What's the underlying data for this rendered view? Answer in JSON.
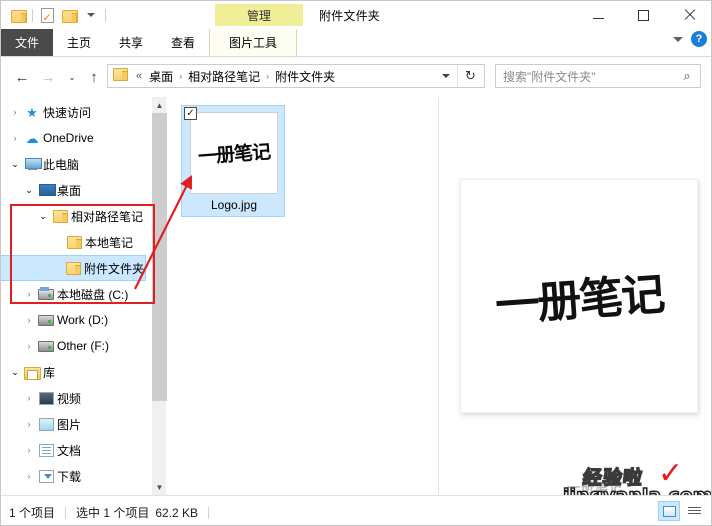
{
  "window": {
    "title": "附件文件夹",
    "minimize_label": "最小化",
    "maximize_label": "最大化",
    "close_label": "关闭"
  },
  "quick_access_toolbar": {
    "items": [
      {
        "name": "folder-icon",
        "label": "属性"
      },
      {
        "name": "properties-icon",
        "label": "属性"
      },
      {
        "name": "new-folder-icon",
        "label": "新建文件夹"
      },
      {
        "name": "customize-caret-icon",
        "label": "自定义快速访问工具栏"
      }
    ]
  },
  "ribbon": {
    "contextual_group_label": "管理",
    "tabs": [
      {
        "label": "文件",
        "active": true
      },
      {
        "label": "主页",
        "active": false
      },
      {
        "label": "共享",
        "active": false
      },
      {
        "label": "查看",
        "active": false
      },
      {
        "label": "图片工具",
        "active": false,
        "contextual": true
      }
    ],
    "collapse_label": "展开功能区",
    "help_label": "?"
  },
  "navigation": {
    "back_label": "←",
    "forward_label": "→",
    "recent_label": "⌄",
    "up_label": "↑",
    "refresh_label": "↻",
    "dropdown_label": "⌄"
  },
  "address_bar": {
    "separator": "«",
    "crumbs": [
      "桌面",
      "相对路径笔记",
      "附件文件夹"
    ],
    "crumb_separator": "›"
  },
  "search": {
    "placeholder": "搜索\"附件文件夹\"",
    "icon": "search-icon"
  },
  "tree": {
    "items": [
      {
        "label": "快速访问",
        "indent": 0,
        "twist": "›",
        "icon": "star-icon",
        "selected": false
      },
      {
        "label": "OneDrive",
        "indent": 0,
        "twist": "›",
        "icon": "cloud-icon",
        "selected": false
      },
      {
        "label": "此电脑",
        "indent": 0,
        "twist": "⌄",
        "icon": "pc-icon",
        "selected": false
      },
      {
        "label": "桌面",
        "indent": 1,
        "twist": "⌄",
        "icon": "desktop-icon",
        "selected": false
      },
      {
        "label": "相对路径笔记",
        "indent": 2,
        "twist": "⌄",
        "icon": "folder-icon",
        "selected": false
      },
      {
        "label": "本地笔记",
        "indent": 3,
        "twist": "",
        "icon": "folder-icon",
        "selected": false
      },
      {
        "label": "附件文件夹",
        "indent": 3,
        "twist": "",
        "icon": "folder-icon",
        "selected": true
      },
      {
        "label": "本地磁盘 (C:)",
        "indent": 1,
        "twist": "›",
        "icon": "drive-sys-icon",
        "selected": false
      },
      {
        "label": "Work (D:)",
        "indent": 1,
        "twist": "›",
        "icon": "drive-icon",
        "selected": false
      },
      {
        "label": "Other (F:)",
        "indent": 1,
        "twist": "›",
        "icon": "drive-icon",
        "selected": false
      },
      {
        "label": "库",
        "indent": 0,
        "twist": "⌄",
        "icon": "library-icon",
        "selected": false
      },
      {
        "label": "视频",
        "indent": 1,
        "twist": "›",
        "icon": "video-icon",
        "selected": false
      },
      {
        "label": "图片",
        "indent": 1,
        "twist": "›",
        "icon": "pictures-icon",
        "selected": false
      },
      {
        "label": "文档",
        "indent": 1,
        "twist": "›",
        "icon": "documents-icon",
        "selected": false
      },
      {
        "label": "下载",
        "indent": 1,
        "twist": "›",
        "icon": "downloads-icon",
        "selected": false
      }
    ]
  },
  "files": [
    {
      "name": "Logo.jpg",
      "thumbnail_text": "一册笔记",
      "checked": true,
      "selected": true
    }
  ],
  "preview": {
    "image_text": "一册笔记"
  },
  "status": {
    "item_count": "1 个项目",
    "selection": "选中 1 个项目",
    "size": "62.2 KB",
    "view_large_icons_label": "大图标",
    "view_details_label": "详细信息"
  },
  "watermark": {
    "top": "经验啦",
    "check": "✓",
    "bottom": "jingyanla.com",
    "ghost": "一册笔记"
  },
  "colors": {
    "selection_fill": "#cce8ff",
    "selection_border": "#99d1ff",
    "contextual_tab": "#f0ee96",
    "file_tab": "#4a4a4a",
    "annotation_red": "#e02020",
    "help_blue": "#1a7fd4"
  }
}
